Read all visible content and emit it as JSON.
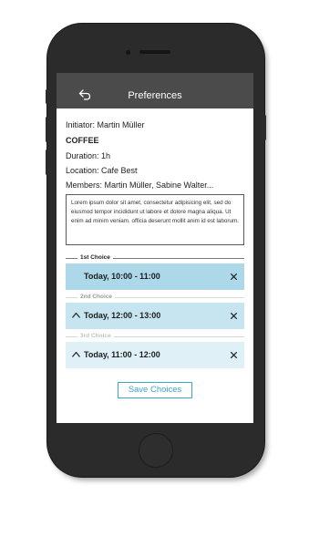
{
  "header": {
    "title": "Preferences"
  },
  "event": {
    "initiator": "Initiator: Martin Müller",
    "name": "COFFEE",
    "duration": "Duration: 1h",
    "location": "Location: Cafe Best",
    "members": "Members: Martin Müller, Sabine Walter...",
    "description": "Lorem ipsum dolor sit amet, consectetur adipisicing elit, sed do eiusmod tempor incididunt ut labore et dolore magna aliqua. Ut enim ad minim veniam. officia deserunt mollit anim id est laborum."
  },
  "choices": [
    {
      "label": "1st Choice",
      "time": "Today, 10:00 - 11:00",
      "color": "#acd8ea"
    },
    {
      "label": "2nd Choice",
      "time": "Today, 12:00 - 13:00",
      "color": "#c7e5f1"
    },
    {
      "label": "3rd Choice",
      "time": "Today, 11:00 - 12:00",
      "color": "#dff0f7"
    }
  ],
  "actions": {
    "save_label": "Save Choices"
  },
  "icons": {
    "back": "back-arrow-icon",
    "move_up": "chevron-up-icon",
    "remove": "close-icon"
  }
}
